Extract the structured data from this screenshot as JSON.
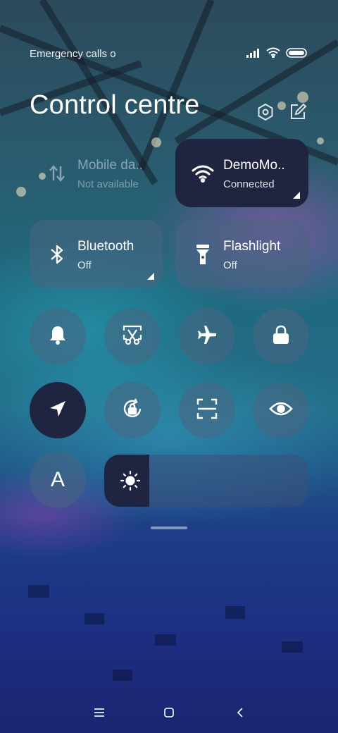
{
  "status_bar": {
    "carrier_text": "Emergency calls o",
    "icons": [
      "signal-icon",
      "wifi-icon",
      "battery-icon"
    ]
  },
  "header": {
    "title": "Control centre",
    "actions": [
      "settings-icon",
      "edit-icon"
    ]
  },
  "tiles": {
    "mobile_data": {
      "title": "Mobile da..",
      "subtitle": "Not available",
      "enabled": false
    },
    "wifi": {
      "title": "DemoMo..",
      "subtitle": "Connected",
      "active": true
    },
    "bluetooth": {
      "title": "Bluetooth",
      "subtitle": "Off",
      "active": false
    },
    "flashlight": {
      "title": "Flashlight",
      "subtitle": "Off",
      "active": false
    }
  },
  "toggles": {
    "row1": [
      {
        "icon": "bell-icon",
        "active": false
      },
      {
        "icon": "screenshot-scissors-icon",
        "active": false
      },
      {
        "icon": "airplane-icon",
        "active": false
      },
      {
        "icon": "lock-icon",
        "active": false
      }
    ],
    "row2": [
      {
        "icon": "location-icon",
        "active": true
      },
      {
        "icon": "rotation-lock-icon",
        "active": false
      },
      {
        "icon": "scan-icon",
        "active": false
      },
      {
        "icon": "eye-icon",
        "active": false
      }
    ],
    "row3": [
      {
        "icon": "font-a-icon",
        "label": "A",
        "active": false
      }
    ]
  },
  "brightness": {
    "level": 0.22,
    "icon": "sun-icon"
  },
  "nav": [
    "menu-icon",
    "home-icon",
    "back-icon"
  ],
  "colors": {
    "active_tile": "#1f2540",
    "glass_tile": "rgba(75,100,130,0.55)"
  }
}
